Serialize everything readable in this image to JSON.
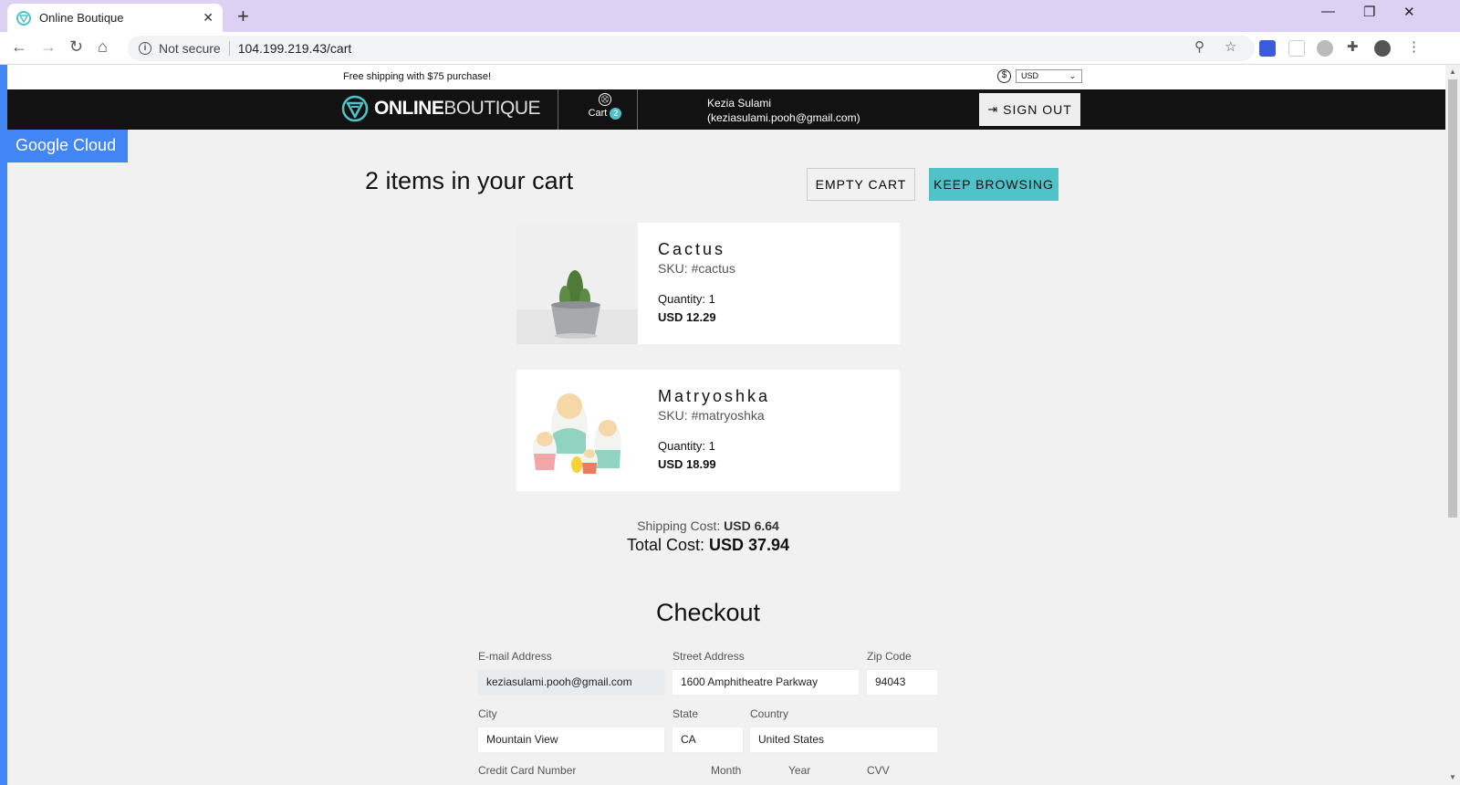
{
  "browser": {
    "tab_title": "Online Boutique",
    "not_secure": "Not secure",
    "url": "104.199.219.43/cart"
  },
  "promo": {
    "text": "Free shipping with $75 purchase!",
    "currency_symbol": "$",
    "currency": "USD"
  },
  "header": {
    "logo_bold": "ONLINE",
    "logo_light": "BOUTIQUE",
    "cart_label": "Cart",
    "cart_count": "2",
    "user_name": "Kezia Sulami",
    "user_email": "(keziasulami.pooh@gmail.com)",
    "sign_out": "SIGN OUT"
  },
  "badge": "Google Cloud",
  "cart": {
    "title": "2 items in your cart",
    "empty_button": "EMPTY CART",
    "keep_button": "KEEP BROWSING",
    "items": [
      {
        "name": "Cactus",
        "sku": "SKU: #cactus",
        "quantity": "Quantity: 1",
        "price": "USD 12.29"
      },
      {
        "name": "Matryoshka",
        "sku": "SKU: #matryoshka",
        "quantity": "Quantity: 1",
        "price": "USD 18.99"
      }
    ],
    "shipping_label": "Shipping Cost:",
    "shipping_value": "USD 6.64",
    "total_label": "Total Cost:",
    "total_value": "USD 37.94"
  },
  "checkout": {
    "title": "Checkout",
    "email_label": "E-mail Address",
    "email_value": "keziasulami.pooh@gmail.com",
    "street_label": "Street Address",
    "street_value": "1600 Amphitheatre Parkway",
    "zip_label": "Zip Code",
    "zip_value": "94043",
    "city_label": "City",
    "city_value": "Mountain View",
    "state_label": "State",
    "state_value": "CA",
    "country_label": "Country",
    "country_value": "United States",
    "card_label": "Credit Card Number",
    "month_label": "Month",
    "year_label": "Year",
    "cvv_label": "CVV"
  },
  "colors": {
    "accent": "#4fc3c8",
    "header_bg": "#121212",
    "google_blue": "#4285f4",
    "tabbar": "#dcd0f3"
  }
}
